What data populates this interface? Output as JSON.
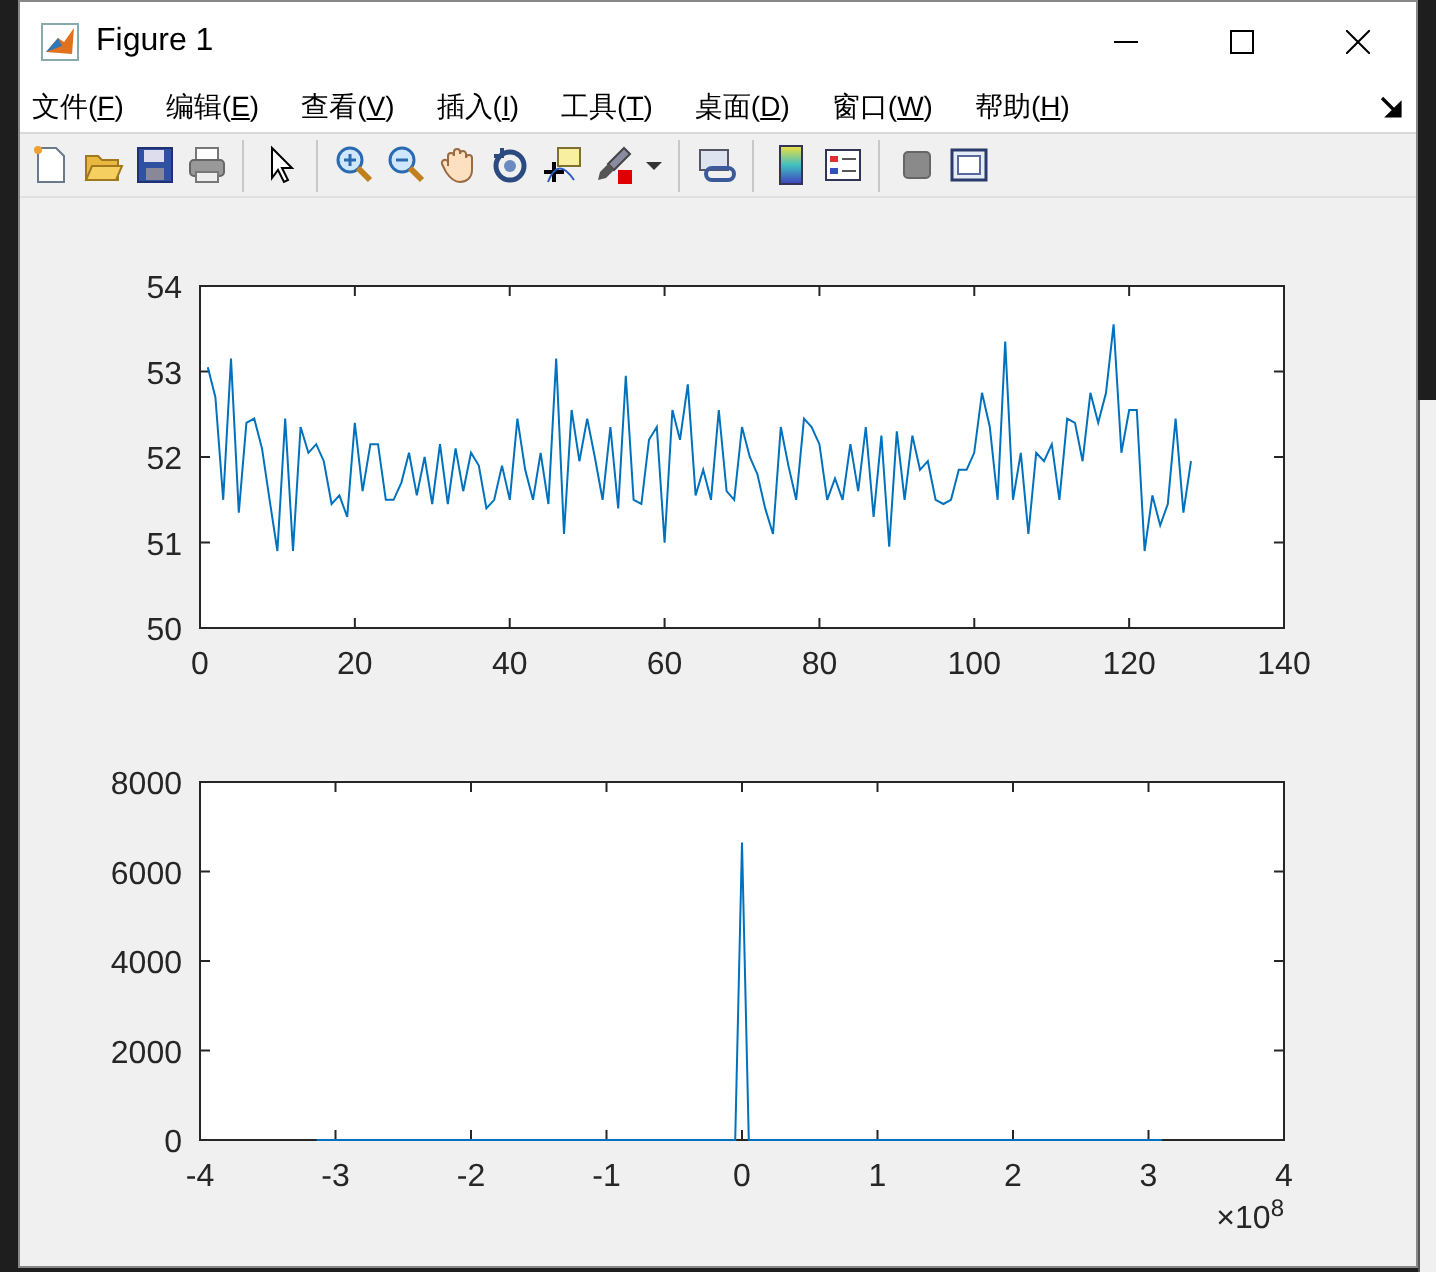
{
  "window": {
    "title": "Figure 1"
  },
  "menu": [
    {
      "label": "文件(F)"
    },
    {
      "label": "编辑(E)"
    },
    {
      "label": "查看(V)"
    },
    {
      "label": "插入(I)"
    },
    {
      "label": "工具(T)"
    },
    {
      "label": "桌面(D)"
    },
    {
      "label": "窗口(W)"
    },
    {
      "label": "帮助(H)"
    }
  ],
  "axes": [
    {
      "chart_data": {
        "type": "line",
        "xlim": [
          0,
          140
        ],
        "ylim": [
          50,
          54
        ],
        "xticks": [
          0,
          20,
          40,
          60,
          80,
          100,
          120,
          140
        ],
        "yticks": [
          50,
          51,
          52,
          53,
          54
        ],
        "x": [
          1,
          2,
          3,
          4,
          5,
          6,
          7,
          8,
          9,
          10,
          11,
          12,
          13,
          14,
          15,
          16,
          17,
          18,
          19,
          20,
          21,
          22,
          23,
          24,
          25,
          26,
          27,
          28,
          29,
          30,
          31,
          32,
          33,
          34,
          35,
          36,
          37,
          38,
          39,
          40,
          41,
          42,
          43,
          44,
          45,
          46,
          47,
          48,
          49,
          50,
          51,
          52,
          53,
          54,
          55,
          56,
          57,
          58,
          59,
          60,
          61,
          62,
          63,
          64,
          65,
          66,
          67,
          68,
          69,
          70,
          71,
          72,
          73,
          74,
          75,
          76,
          77,
          78,
          79,
          80,
          81,
          82,
          83,
          84,
          85,
          86,
          87,
          88,
          89,
          90,
          91,
          92,
          93,
          94,
          95,
          96,
          97,
          98,
          99,
          100,
          101,
          102,
          103,
          104,
          105,
          106,
          107,
          108,
          109,
          110,
          111,
          112,
          113,
          114,
          115,
          116,
          117,
          118,
          119,
          120,
          121,
          122,
          123,
          124,
          125,
          126,
          127,
          128
        ],
        "series": [
          {
            "color": "#0072bd",
            "values": [
              53.05,
              52.7,
              51.5,
              53.15,
              51.35,
              52.4,
              52.45,
              52.1,
              51.5,
              50.9,
              52.45,
              50.9,
              52.35,
              52.05,
              52.15,
              51.95,
              51.45,
              51.55,
              51.3,
              52.4,
              51.6,
              52.15,
              52.15,
              51.5,
              51.5,
              51.7,
              52.05,
              51.55,
              52.0,
              51.45,
              52.15,
              51.45,
              52.1,
              51.6,
              52.05,
              51.9,
              51.4,
              51.5,
              51.9,
              51.5,
              52.45,
              51.85,
              51.5,
              52.05,
              51.45,
              53.15,
              51.1,
              52.55,
              51.95,
              52.45,
              52.0,
              51.5,
              52.35,
              51.4,
              52.95,
              51.5,
              51.45,
              52.2,
              52.35,
              51.0,
              52.55,
              52.2,
              52.85,
              51.55,
              51.85,
              51.5,
              52.55,
              51.6,
              51.5,
              52.35,
              52.0,
              51.8,
              51.4,
              51.1,
              52.35,
              51.9,
              51.5,
              52.45,
              52.35,
              52.15,
              51.5,
              51.75,
              51.5,
              52.15,
              51.6,
              52.35,
              51.3,
              52.25,
              50.95,
              52.3,
              51.5,
              52.25,
              51.85,
              51.95,
              51.5,
              51.45,
              51.5,
              51.85,
              51.85,
              52.05,
              52.75,
              52.35,
              51.5,
              53.35,
              51.5,
              52.05,
              51.1,
              52.05,
              51.95,
              52.15,
              51.5,
              52.45,
              52.4,
              51.95,
              52.75,
              52.4,
              52.75,
              53.55,
              52.05,
              52.55,
              52.55,
              50.9,
              51.55,
              51.2,
              51.45,
              52.45,
              51.35,
              51.95
            ]
          }
        ]
      }
    },
    {
      "x_exponent": "×10$^{8}$",
      "chart_data": {
        "type": "line",
        "xlim": [
          -4,
          4
        ],
        "ylim": [
          0,
          8000
        ],
        "xticks": [
          -4,
          -3,
          -2,
          -1,
          0,
          1,
          2,
          3,
          4
        ],
        "yticks": [
          0,
          2000,
          4000,
          6000,
          8000
        ],
        "x": [
          -3.14,
          -0.05,
          0,
          0.05,
          3.1
        ],
        "series": [
          {
            "color": "#0072bd",
            "values": [
              0,
              0,
              6650,
              0,
              0
            ]
          }
        ]
      }
    }
  ]
}
